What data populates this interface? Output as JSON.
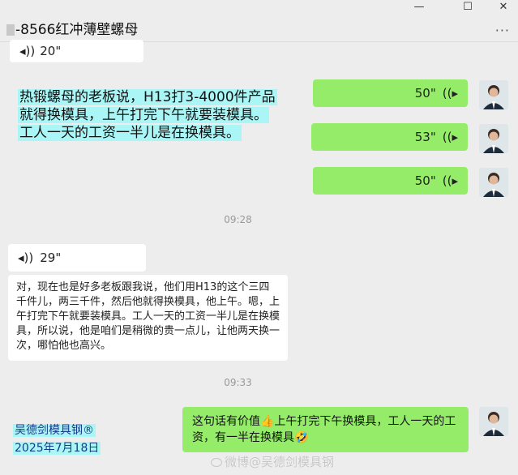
{
  "window": {
    "title": "-8566红冲薄壁螺母",
    "minimize_glyph": "—",
    "maximize_glyph": "☐",
    "close_glyph": "✕",
    "more_glyph": "···"
  },
  "chat": {
    "top_partial_voice": {
      "duration": "20\""
    },
    "highlight_text": [
      "热锻螺母的老板说，H13打3-4000件产品",
      "就得换模具，上午打完下午就要装模具。",
      "工人一天的工资一半儿是在换模具。"
    ],
    "right_voices": [
      {
        "duration": "50\""
      },
      {
        "duration": "53\""
      },
      {
        "duration": "50\""
      }
    ],
    "timestamp_1": "09:28",
    "left_voice": {
      "duration": "29\""
    },
    "left_transcript": "对，现在也是好多老板跟我说，他们用H13的这个三四千件儿，两三千件，然后他就得换模具，他上午。嗯，上午打完下午就要装模具。工人一天的工资一半儿是在换模具，所以说，他是咱们是稍微的贵一点儿，让他两天换一次，哪怕他也高兴。",
    "timestamp_2": "09:33",
    "last_message": "这句话有价值👍上午打完下午换模具，工人一天的工资，有一半在换模具🤣"
  },
  "signature": {
    "name": "吴德剑模具钢®",
    "date": "2025年7月18日"
  },
  "watermark": "微博@吴德剑模具钢",
  "icons": [
    "voice-icon",
    "avatar-icon",
    "more-icon",
    "weibo-icon"
  ],
  "colors": {
    "background": "#ededed",
    "left_bubble": "#ffffff",
    "right_bubble": "#95ec69",
    "highlight": "#aaf5f5",
    "signature_text": "#1a3b8a"
  }
}
